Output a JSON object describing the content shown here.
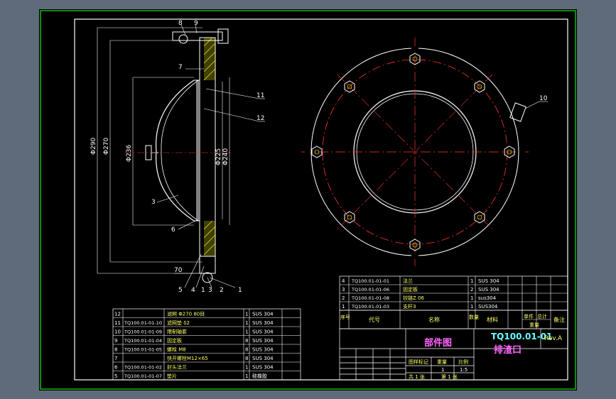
{
  "balloons_side": [
    "8",
    "9",
    "7",
    "11",
    "12",
    "3",
    "6",
    "5",
    "4",
    "1",
    "3",
    "2",
    "1"
  ],
  "dims": {
    "d1": "Φ290",
    "d2": "Φ270",
    "d3": "Φ236",
    "d4": "Φ225",
    "d5": "Φ240",
    "d6": "70"
  },
  "balloon_front": "10",
  "parts_table": {
    "rows": [
      {
        "no": "12",
        "code": "",
        "name": "滤网 Φ270 80目",
        "qty": "1",
        "mat": "SUS 304"
      },
      {
        "no": "11",
        "code": "TQ100.01-01-10",
        "name": "滤网垫 δ2",
        "qty": "1",
        "mat": "SUS 304"
      },
      {
        "no": "10",
        "code": "TQ100.01-01-09",
        "name": "限制轴套",
        "qty": "1",
        "mat": "SUS 304"
      },
      {
        "no": "9",
        "code": "TQ100.01-01-04",
        "name": "固定板",
        "qty": "8",
        "mat": "SUS 304"
      },
      {
        "no": "8",
        "code": "TQ100.01-01-05",
        "name": "螺栓 M8",
        "qty": "8",
        "mat": "SUS 304"
      },
      {
        "no": "7",
        "code": "",
        "name": "快开螺栓M12×65",
        "qty": "8",
        "mat": "SUS 304"
      },
      {
        "no": "6",
        "code": "TQ100.01-01-02",
        "name": "封头法兰",
        "qty": "1",
        "mat": "SUS 304"
      },
      {
        "no": "5",
        "code": "TQ100.01-01-07",
        "name": "垫片",
        "qty": "1",
        "mat": "硅橡胶"
      }
    ]
  },
  "bom": {
    "rows": [
      {
        "no": "4",
        "code": "TQ100.01-01-01",
        "name": "法兰",
        "qty": "1",
        "mat": "SUS 304"
      },
      {
        "no": "3",
        "code": "TQ100.01-01-06",
        "name": "固定板",
        "qty": "2",
        "mat": "SUS 304"
      },
      {
        "no": "2",
        "code": "TQ100.01-01-08",
        "name": "铰链Z 06",
        "qty": "1",
        "mat": "sus304"
      },
      {
        "no": "1",
        "code": "TQ100.01-01-03",
        "name": "支杆3",
        "qty": "1",
        "mat": "SUS304"
      }
    ],
    "header": {
      "no": "序号",
      "code": "代号",
      "name": "名称",
      "qty": "数量",
      "mat": "材料",
      "single": "单件",
      "total": "总计",
      "weight": "重量",
      "remark": "备注"
    }
  },
  "title_block": {
    "type_label": "部件图",
    "drawing_no": "TQ100.01-01",
    "name": "排渣口",
    "rev": "Rev.A",
    "stage_label": "图样标记",
    "weight_label": "重量",
    "scale_label": "比例",
    "qty": "1",
    "scale": "1:5",
    "sheet_total": "共 1 张",
    "sheet_no": "第 1 张"
  }
}
